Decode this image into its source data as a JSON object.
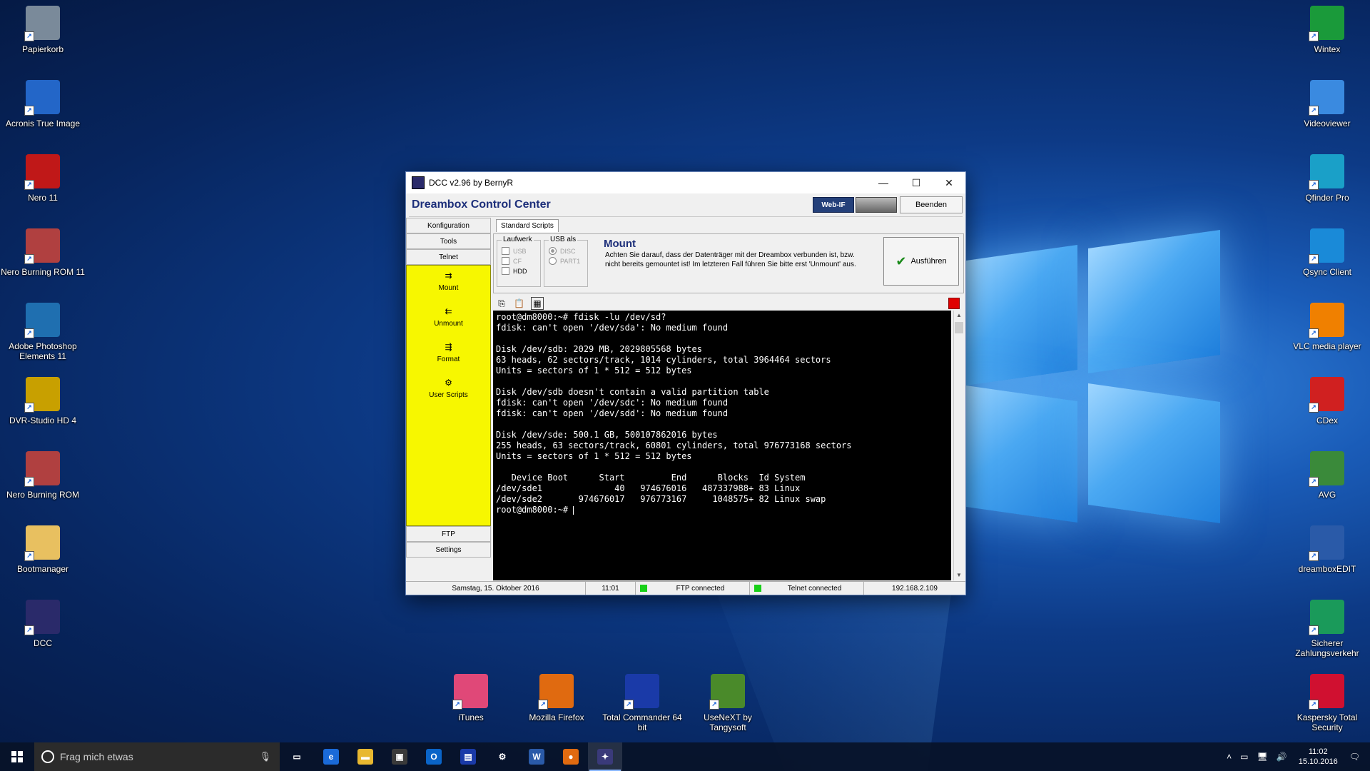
{
  "desktop": {
    "left_icons": [
      {
        "label": "Papierkorb",
        "icon": "recycle-bin-icon",
        "color": "#7a8a9a"
      },
      {
        "label": "Acronis True Image",
        "icon": "acronis-icon",
        "color": "#2366c8"
      },
      {
        "label": "Nero 11",
        "icon": "nero-icon",
        "color": "#c01818"
      },
      {
        "label": "Nero Burning ROM 11",
        "icon": "nero-burning-rom-icon",
        "color": "#b04040"
      },
      {
        "label": "Adobe Photoshop Elements 11",
        "icon": "photoshop-elements-icon",
        "color": "#1f6fb0"
      },
      {
        "label": "DVR-Studio HD 4",
        "icon": "dvr-studio-icon",
        "color": "#c8a000"
      },
      {
        "label": "Nero Burning ROM",
        "icon": "nero-burning-rom-icon",
        "color": "#b04040"
      },
      {
        "label": "Bootmanager",
        "icon": "folder-icon",
        "color": "#e8c060"
      },
      {
        "label": "DCC",
        "icon": "dcc-icon",
        "color": "#2a2a6a"
      }
    ],
    "right_icons": [
      {
        "label": "Wintex",
        "icon": "wintex-icon",
        "color": "#1a9a3a"
      },
      {
        "label": "Videoviewer",
        "icon": "videoviewer-icon",
        "color": "#3a8ae0"
      },
      {
        "label": "Qfinder Pro",
        "icon": "qfinder-icon",
        "color": "#1aa0c8"
      },
      {
        "label": "Qsync Client",
        "icon": "qsync-icon",
        "color": "#1a8ad8"
      },
      {
        "label": "VLC media player",
        "icon": "vlc-icon",
        "color": "#f08000"
      },
      {
        "label": "CDex",
        "icon": "cdex-icon",
        "color": "#d02020"
      },
      {
        "label": "AVG",
        "icon": "avg-icon",
        "color": "#3a8a3a"
      },
      {
        "label": "dreamboxEDIT",
        "icon": "dreamboxedit-icon",
        "color": "#2a5aa8"
      },
      {
        "label": "Sicherer Zahlungsverkehr",
        "icon": "safe-money-icon",
        "color": "#1a9a5a"
      },
      {
        "label": "Kaspersky Total Security",
        "icon": "kaspersky-icon",
        "color": "#d01030"
      }
    ],
    "bottom_icons": [
      {
        "label": "iTunes",
        "icon": "itunes-icon",
        "color": "#e04878"
      },
      {
        "label": "Mozilla Firefox",
        "icon": "firefox-icon",
        "color": "#e06a10"
      },
      {
        "label": "Total Commander 64 bit",
        "icon": "total-commander-icon",
        "color": "#1a3aa8"
      },
      {
        "label": "UseNeXT by Tangysoft",
        "icon": "usenext-icon",
        "color": "#4a8a2a"
      }
    ]
  },
  "window": {
    "title": "DCC v2.96 by BernyR",
    "header_title": "Dreambox Control Center",
    "webif_label": "Web-IF",
    "beenden_label": "Beenden",
    "nav_top": [
      "Konfiguration",
      "Tools",
      "Telnet"
    ],
    "yellow_items": [
      {
        "label": "Mount",
        "icon": "mount-icon",
        "glyph": "⇉"
      },
      {
        "label": "Unmount",
        "icon": "unmount-icon",
        "glyph": "⇇"
      },
      {
        "label": "Format",
        "icon": "format-icon",
        "glyph": "⇶"
      },
      {
        "label": "User Scripts",
        "icon": "user-scripts-icon",
        "glyph": "⚙"
      }
    ],
    "nav_bottom": [
      "FTP",
      "Settings"
    ],
    "tab_label": "Standard Scripts",
    "laufwerk": {
      "legend": "Laufwerk",
      "options": [
        {
          "label": "USB",
          "checked": false,
          "enabled": false
        },
        {
          "label": "CF",
          "checked": false,
          "enabled": false
        },
        {
          "label": "HDD",
          "checked": false,
          "enabled": true
        }
      ]
    },
    "usb_als": {
      "legend": "USB als",
      "options": [
        {
          "label": "DISC",
          "selected": true
        },
        {
          "label": "PART1",
          "selected": false
        }
      ]
    },
    "mount_title": "Mount",
    "mount_text": "Achten Sie darauf, dass der Datenträger mit der Dreambox verbunden ist, bzw. nicht bereits gemountet ist! Im letzteren Fall führen Sie bitte erst 'Unmount' aus.",
    "run_label": "Ausführen",
    "terminal_lines": [
      "root@dm8000:~# fdisk -lu /dev/sd?",
      "fdisk: can't open '/dev/sda': No medium found",
      "",
      "Disk /dev/sdb: 2029 MB, 2029805568 bytes",
      "63 heads, 62 sectors/track, 1014 cylinders, total 3964464 sectors",
      "Units = sectors of 1 * 512 = 512 bytes",
      "",
      "Disk /dev/sdb doesn't contain a valid partition table",
      "fdisk: can't open '/dev/sdc': No medium found",
      "fdisk: can't open '/dev/sdd': No medium found",
      "",
      "Disk /dev/sde: 500.1 GB, 500107862016 bytes",
      "255 heads, 63 sectors/track, 60801 cylinders, total 976773168 sectors",
      "Units = sectors of 1 * 512 = 512 bytes",
      "",
      "   Device Boot      Start         End      Blocks  Id System",
      "/dev/sde1              40   974676016   487337988+ 83 Linux",
      "/dev/sde2       974676017   976773167     1048575+ 82 Linux swap"
    ],
    "prompt": "root@dm8000:~# ",
    "status": {
      "date": "Samstag, 15. Oktober 2016",
      "time": "11:01",
      "ftp": "FTP connected",
      "telnet": "Telnet connected",
      "ip": "192.168.2.109"
    }
  },
  "taskbar": {
    "search_placeholder": "Frag mich etwas",
    "apps": [
      {
        "icon": "task-view-icon",
        "glyph": "▭",
        "color": "transparent",
        "active": false
      },
      {
        "icon": "edge-icon",
        "glyph": "e",
        "color": "#1a6ad8",
        "active": false
      },
      {
        "icon": "file-explorer-icon",
        "glyph": "▬",
        "color": "#e8b830",
        "active": false
      },
      {
        "icon": "store-icon",
        "glyph": "▣",
        "color": "#3a3a3a",
        "active": false
      },
      {
        "icon": "outlook-icon",
        "glyph": "O",
        "color": "#0a64c8",
        "active": false
      },
      {
        "icon": "total-commander-icon",
        "glyph": "▤",
        "color": "#1a3aa8",
        "active": false
      },
      {
        "icon": "settings-icon",
        "glyph": "⚙",
        "color": "transparent",
        "active": false
      },
      {
        "icon": "word-icon",
        "glyph": "W",
        "color": "#2a5aa8",
        "active": false
      },
      {
        "icon": "firefox-icon",
        "glyph": "●",
        "color": "#e06a10",
        "active": false
      },
      {
        "icon": "dcc-icon",
        "glyph": "✦",
        "color": "#3a3a7a",
        "active": true
      }
    ],
    "clock_time": "11:02",
    "clock_date": "15.10.2016"
  }
}
